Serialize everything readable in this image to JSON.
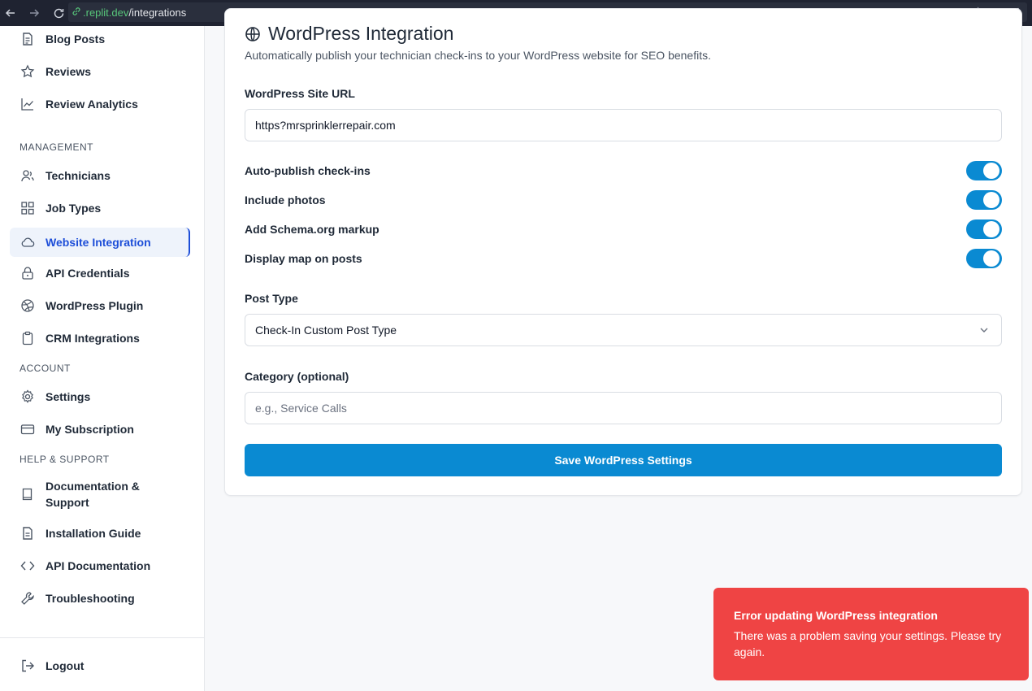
{
  "browser": {
    "url_domain": ".replit.dev",
    "url_path": "/integrations"
  },
  "sidebar": {
    "top_items": [
      {
        "label": "Blog Posts",
        "icon": "file-text-icon"
      },
      {
        "label": "Reviews",
        "icon": "star-icon"
      },
      {
        "label": "Review Analytics",
        "icon": "line-chart-icon"
      }
    ],
    "management_label": "MANAGEMENT",
    "management_items": [
      {
        "label": "Technicians",
        "icon": "users-icon"
      },
      {
        "label": "Job Types",
        "icon": "grid-icon"
      },
      {
        "label": "Website Integration",
        "icon": "cloud-icon",
        "active": true
      },
      {
        "label": "API Credentials",
        "icon": "lock-icon"
      },
      {
        "label": "WordPress Plugin",
        "icon": "dribbble-icon"
      },
      {
        "label": "CRM Integrations",
        "icon": "clipboard-icon"
      }
    ],
    "account_label": "ACCOUNT",
    "account_items": [
      {
        "label": "Settings",
        "icon": "gear-icon"
      },
      {
        "label": "My Subscription",
        "icon": "credit-card-icon"
      }
    ],
    "help_label": "HELP & SUPPORT",
    "help_items": [
      {
        "label": "Documentation & Support",
        "icon": "book-icon"
      },
      {
        "label": "Installation Guide",
        "icon": "file-icon"
      },
      {
        "label": "API Documentation",
        "icon": "code-icon"
      },
      {
        "label": "Troubleshooting",
        "icon": "wrench-icon"
      }
    ],
    "logout_label": "Logout"
  },
  "main": {
    "title": "WordPress Integration",
    "description": "Automatically publish your technician check-ins to your WordPress website for SEO benefits.",
    "site_url_label": "WordPress Site URL",
    "site_url_value": "https?mrsprinklerrepair.com",
    "toggles": [
      {
        "label": "Auto-publish check-ins",
        "on": true
      },
      {
        "label": "Include photos",
        "on": true
      },
      {
        "label": "Add Schema.org markup",
        "on": true
      },
      {
        "label": "Display map on posts",
        "on": true
      }
    ],
    "post_type_label": "Post Type",
    "post_type_value": "Check-In Custom Post Type",
    "category_label": "Category (optional)",
    "category_placeholder": "e.g., Service Calls",
    "save_label": "Save WordPress Settings"
  },
  "toast": {
    "title": "Error updating WordPress integration",
    "message": "There was a problem saving your settings. Please try again."
  },
  "colors": {
    "accent": "#0a8ad2",
    "error": "#ef4444",
    "active_link": "#1d4ed8"
  }
}
